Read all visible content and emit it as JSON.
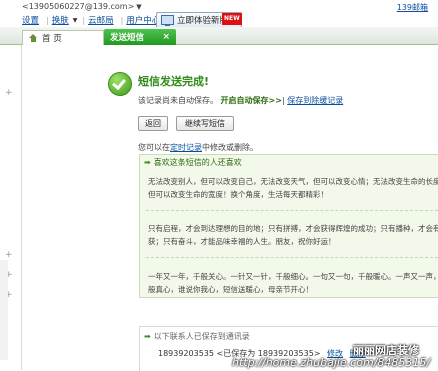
{
  "header": {
    "account": "<13905060227@139.com>",
    "mailbox_link": "139邮箱",
    "nav": [
      "设置",
      "换肤",
      "云邮局",
      "用户中心"
    ],
    "upgrade_button": "立即体验新版",
    "new_badge": "NEW"
  },
  "tabs": [
    {
      "label": "首 页"
    },
    {
      "label": "发送短信",
      "close": "×"
    }
  ],
  "main": {
    "success_title": "短信发送完成!",
    "autosave_prefix": "该记录尚未自动保存。",
    "autosave_enable": "开启自动保存>>",
    "autosave_sep": "|",
    "save_record": "保存到除缓记录",
    "back_button": "返回",
    "continue_button": "继续写短信",
    "timed_prefix": "您可以在",
    "timed_link": "定时记录",
    "timed_suffix": "中修改或删除。"
  },
  "greetings": {
    "title": "喜欢这条短信的人还喜欢",
    "items": [
      "无法改变别人，但可以改变自己，无法改变天气，但可以改变心情；无法改变生命的长度，但可以改变生命的宽度！换个角度，生活每天都精彩！",
      "只有启程，才会到达理想的目的地；只有拼搏，才会获得辉煌的成功；只有播种，才会有收获；只有奋斗，才能品味幸福的人生。朋友，祝你好运！",
      "一年又一年，千般关心。一针又一针，千般细心。一句又一句，千般暖心。一声又一声，千般真心，谁说你我心，短信送暖心，母亲节开心！"
    ]
  },
  "contacts": {
    "header": "以下联系人已保存到通讯录",
    "number": "18939203535",
    "saved_as": "<已保存为 18939203535>",
    "edit": "修改",
    "delete": "删除"
  },
  "watermark": {
    "title": "丽丽网店装修",
    "url": "http://home.zhubajie.com/8485315/"
  }
}
